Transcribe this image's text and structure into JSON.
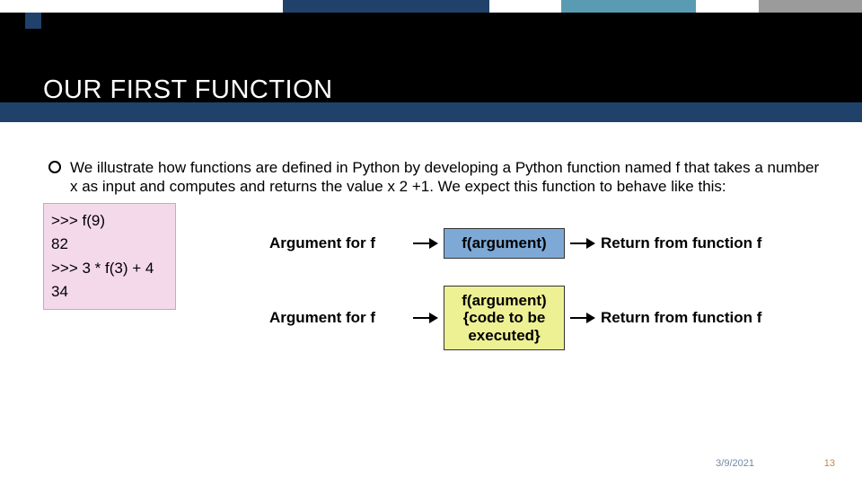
{
  "title": "OUR FIRST FUNCTION",
  "bullet": "We illustrate how functions are defined in Python by developing a Python function named f that takes a number x as input and computes and returns the value x 2 +1. We expect this function to behave like this:",
  "code": {
    "l1": ">>> f(9)",
    "l2": "82",
    "l3": ">>> 3 * f(3) + 4",
    "l4": "34"
  },
  "diagram": {
    "row1": {
      "left": "Argument for f",
      "box": "f(argument)",
      "right": "Return from function f"
    },
    "row2": {
      "left": "Argument for f",
      "box": "f(argument)\n{code to be\nexecuted}",
      "right": "Return from function f"
    }
  },
  "footer": {
    "date": "3/9/2021",
    "page": "13"
  }
}
